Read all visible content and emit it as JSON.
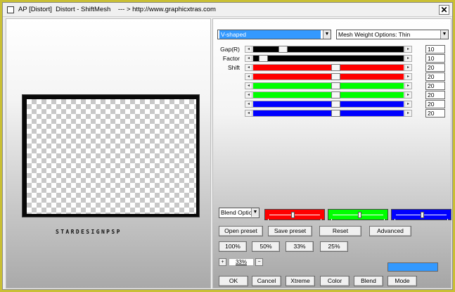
{
  "window": {
    "title": "AP [Distort]  Distort - ShiftMesh    --- > http://www.graphicxtras.com",
    "close_glyph": "✕"
  },
  "preview": {
    "watermark": "STARDESIGNPSP"
  },
  "controls": {
    "mode_dropdown": {
      "value": "V-shaped"
    },
    "mesh_dropdown": {
      "value": "Mesh Weight Options: Thin"
    },
    "blend_dropdown": {
      "value": "Blend Optic"
    },
    "arrow_glyph": "▼"
  },
  "sliders": [
    {
      "label": "Gap(R)",
      "value": "10",
      "color": "#000000",
      "level": 0.18
    },
    {
      "label": "Factor",
      "value": "10",
      "color": "#000000",
      "level": 0.04
    },
    {
      "label": "Shift",
      "value": "20",
      "color": "#ff0000",
      "level": 0.55
    },
    {
      "label": "",
      "value": "20",
      "color": "#ff0000",
      "level": 0.55
    },
    {
      "label": "",
      "value": "20",
      "color": "#00ff00",
      "level": 0.55
    },
    {
      "label": "",
      "value": "20",
      "color": "#00ff00",
      "level": 0.55
    },
    {
      "label": "",
      "value": "20",
      "color": "#0000ff",
      "level": 0.55
    },
    {
      "label": "",
      "value": "20",
      "color": "#0000ff",
      "level": 0.55
    }
  ],
  "slider_arrows": {
    "left": "◂",
    "right": "▸"
  },
  "color_sliders": [
    {
      "color": "#ff0000",
      "level": 0.45
    },
    {
      "color": "#00ff00",
      "level": 0.52
    },
    {
      "color": "#0000ff",
      "level": 0.5
    }
  ],
  "preset_buttons": {
    "open": "Open preset",
    "save": "Save preset",
    "reset": "Reset",
    "advanced": "Advanced"
  },
  "zoom_buttons": [
    "100%",
    "50%",
    "33%",
    "25%"
  ],
  "zoom": {
    "plus": "+",
    "minus": "−",
    "value": "33%"
  },
  "swatch_color": "#3399ff",
  "bottom_buttons": {
    "ok": "OK",
    "cancel": "Cancel",
    "xtreme": "Xtreme",
    "color": "Color",
    "blend": "Blend",
    "mode": "Mode"
  }
}
